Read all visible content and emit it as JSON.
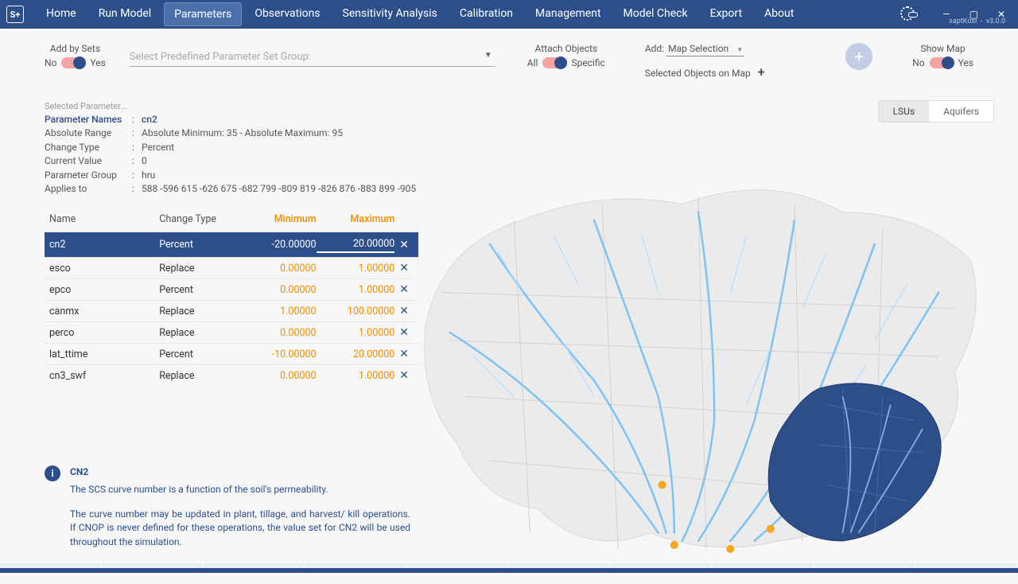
{
  "app": {
    "project": "saptKosi",
    "version": "v3.0.0"
  },
  "menu": {
    "items": [
      "Home",
      "Run Model",
      "Parameters",
      "Observations",
      "Sensitivity Analysis",
      "Calibration",
      "Management",
      "Model Check",
      "Export",
      "About"
    ],
    "active": "Parameters"
  },
  "toolbar": {
    "addbysets_label": "Add by Sets",
    "no": "No",
    "yes": "Yes",
    "select_placeholder": "Select Predefined Parameter Set Group:",
    "attach_label": "Attach Objects",
    "all": "All",
    "specific": "Specific",
    "add_label": "Add:",
    "add_value": "Map Selection",
    "selected_objects": "Selected Objects on Map",
    "showmap_label": "Show Map"
  },
  "param_info": {
    "header": "Selected Parameter...",
    "names_k": "Parameter Names",
    "names_v": "cn2",
    "range_k": "Absolute Range",
    "range_v": "Absolute Minimum: 35 - Absolute Maximum: 95",
    "ct_k": "Change Type",
    "ct_v": "Percent",
    "cv_k": "Current Value",
    "cv_v": "0",
    "grp_k": "Parameter Group",
    "grp_v": "hru",
    "app_k": "Applies to",
    "app_v": "588  -596  615  -626  675  -682  799  -809  819  -826  876  -883  899  -905"
  },
  "table": {
    "headers": {
      "name": "Name",
      "ct": "Change Type",
      "min": "Minimum",
      "max": "Maximum"
    },
    "rows": [
      {
        "name": "cn2",
        "ct": "Percent",
        "min": "-20.00000",
        "max": "20.00000",
        "selected": true
      },
      {
        "name": "esco",
        "ct": "Replace",
        "min": "0.00000",
        "max": "1.00000"
      },
      {
        "name": "epco",
        "ct": "Percent",
        "min": "0.00000",
        "max": "1.00000"
      },
      {
        "name": "canmx",
        "ct": "Replace",
        "min": "1.00000",
        "max": "100.00000"
      },
      {
        "name": "perco",
        "ct": "Replace",
        "min": "0.00000",
        "max": "1.00000"
      },
      {
        "name": "lat_ttime",
        "ct": "Percent",
        "min": "-10.00000",
        "max": "20.00000"
      },
      {
        "name": "cn3_swf",
        "ct": "Replace",
        "min": "0.00000",
        "max": "1.00000"
      }
    ]
  },
  "info": {
    "title": "CN2",
    "p1": "The SCS curve number is a function of the soil's permeability.",
    "p2": "The curve number may be updated in plant, tillage, and harvest/ kill operations. If CNOP is never defined for these operations, the value set for CN2 will be used throughout the simulation."
  },
  "tabs": {
    "a": "LSUs",
    "b": "Aquifers"
  }
}
